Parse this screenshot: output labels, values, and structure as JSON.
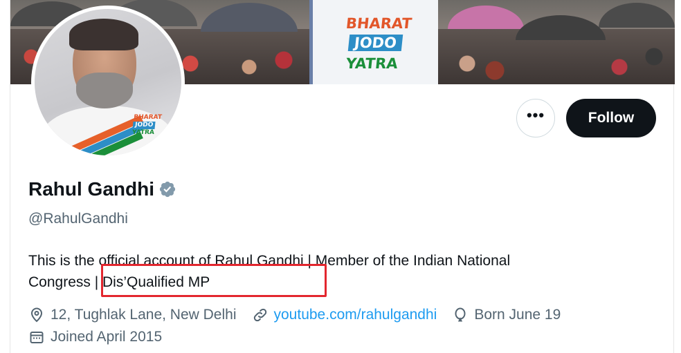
{
  "banner": {
    "campaign_logo": {
      "line1": "BHARAT",
      "line2": "JODO",
      "line3": "YATRA"
    }
  },
  "avatar": {
    "logo": {
      "line1": "BHARAT",
      "line2": "JODO",
      "line3": "YATRA"
    }
  },
  "actions": {
    "more_label": "•••",
    "follow_label": "Follow"
  },
  "profile": {
    "name": "Rahul Gandhi",
    "handle": "@RahulGandhi",
    "verified": true,
    "bio_line1": "This is the official account of Rahul Gandhi | Member of the Indian National",
    "bio_line2": "Congress | Dis’Qualified MP"
  },
  "meta": {
    "location": "12, Tughlak Lane, New Delhi",
    "website": "youtube.com/rahulgandhi",
    "birthday": "Born June 19",
    "joined": "Joined April 2015"
  },
  "colors": {
    "primary_text": "#0f1419",
    "secondary_text": "#536471",
    "link": "#1d9bf0",
    "verified_badge": "#829aab",
    "highlight": "#e3262e"
  },
  "icons": [
    "location-icon",
    "link-icon",
    "balloon-icon",
    "calendar-icon",
    "verified-badge-icon",
    "more-icon"
  ]
}
